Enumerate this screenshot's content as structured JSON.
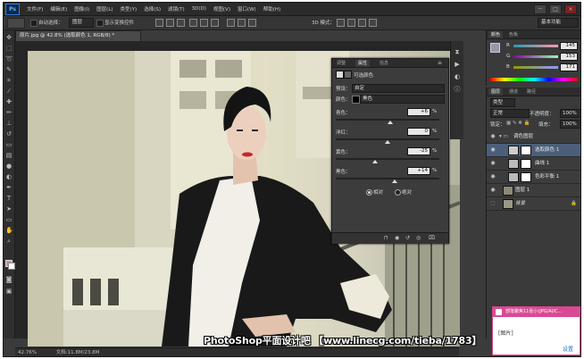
{
  "app": {
    "logo": "Ps"
  },
  "menu": {
    "items": [
      "文件(F)",
      "编辑(E)",
      "图像(I)",
      "图层(L)",
      "类型(Y)",
      "选择(S)",
      "滤镜(T)",
      "3D(D)",
      "视图(V)",
      "窗口(W)",
      "帮助(H)"
    ],
    "window_buttons": [
      "－",
      "□",
      "×"
    ]
  },
  "options": {
    "auto_select_label": "自动选择：",
    "auto_select_value": "图层",
    "show_transform_label": "显示变换控件",
    "mode_3d_label": "3D 模式：",
    "workspace": "基本功能"
  },
  "document": {
    "tab_title": "原片.jpg @ 42.8% (选取颜色 1, RGB/8) *",
    "zoom": "42.76%",
    "doc_info": "文档:11.8M/23.8M"
  },
  "properties": {
    "tabs": [
      "调整",
      "属性",
      "信息"
    ],
    "title": "可选颜色",
    "preset_label": "预设：",
    "preset_value": "自定",
    "colors_label": "颜色：",
    "colors_value": "黑色",
    "sliders": [
      {
        "label": "青色：",
        "value": "+6",
        "unit": "%",
        "level": 0.53
      },
      {
        "label": "洋红：",
        "value": "0",
        "unit": "%",
        "level": 0.5
      },
      {
        "label": "黄色：",
        "value": "-25",
        "unit": "%",
        "level": 0.375
      },
      {
        "label": "黑色：",
        "value": "+14",
        "unit": "%",
        "level": 0.57
      }
    ],
    "relative_label": "相对",
    "absolute_label": "绝对"
  },
  "color_panel": {
    "tabs": [
      "颜色",
      "色板"
    ],
    "channels": [
      {
        "label": "R",
        "value": "145",
        "level": 0.57
      },
      {
        "label": "G",
        "value": "153",
        "level": 0.6
      },
      {
        "label": "B",
        "value": "171",
        "level": 0.67
      }
    ]
  },
  "layers_panel": {
    "tabs": [
      "图层",
      "通道",
      "路径"
    ],
    "kind_label": "类型",
    "blend_mode": "正常",
    "opacity_label": "不透明度：",
    "opacity_value": "100%",
    "lock_label": "锁定：",
    "fill_label": "填充：",
    "fill_value": "100%",
    "layers": [
      {
        "name": "调色图层",
        "type": "group",
        "selected": false
      },
      {
        "name": "选取颜色 1",
        "type": "adjustment",
        "selected": true
      },
      {
        "name": "曲线 1",
        "type": "adjustment",
        "selected": false
      },
      {
        "name": "色彩平衡 1",
        "type": "adjustment",
        "selected": false
      },
      {
        "name": "图层 1",
        "type": "pixel",
        "selected": false
      },
      {
        "name": "背景",
        "type": "background",
        "selected": false
      }
    ]
  },
  "watermark": {
    "text": "PhotoShop平面设计吧 【www.linecg.com/tieba/1783】"
  },
  "notification": {
    "title": "部落聚焦11张小(JPG/AI/C...",
    "body": "[图片]",
    "action": "设置"
  }
}
